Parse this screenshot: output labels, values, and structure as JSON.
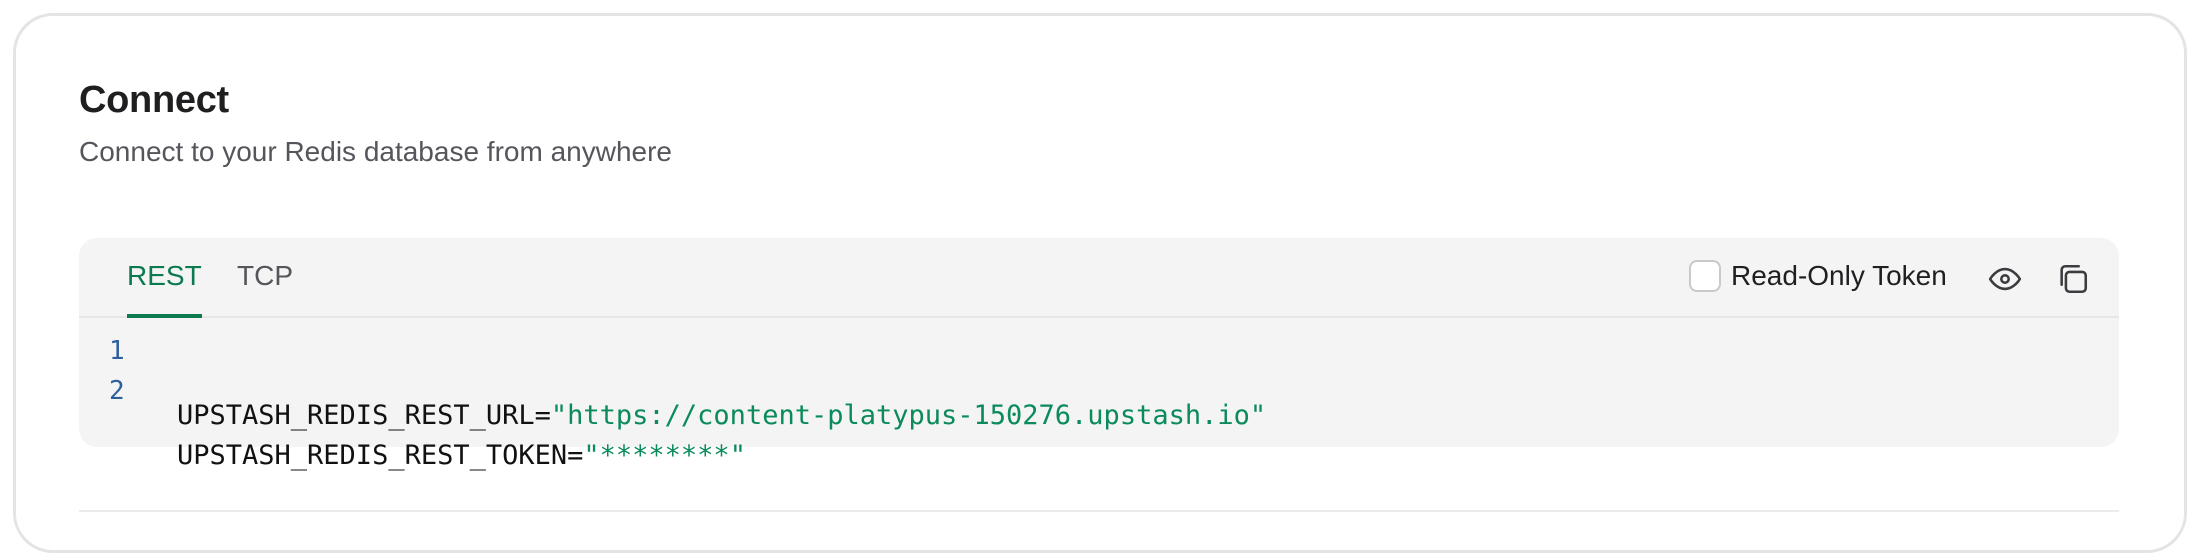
{
  "header": {
    "title": "Connect",
    "subtitle": "Connect to your Redis database from anywhere"
  },
  "tabs": [
    {
      "label": "REST",
      "active": true
    },
    {
      "label": "TCP",
      "active": false
    }
  ],
  "read_only": {
    "label": "Read-Only Token",
    "checked": false
  },
  "icons": {
    "reveal": "eye-icon",
    "copy": "copy-icon"
  },
  "code_lines": [
    {
      "number": "1",
      "key": "UPSTASH_REDIS_REST_URL=",
      "value": "\"https://content-platypus-150276.upstash.io\""
    },
    {
      "number": "2",
      "key": "UPSTASH_REDIS_REST_TOKEN=",
      "value": "\"********\""
    }
  ],
  "colors": {
    "accent": "#0b7a4f",
    "string": "#0b8a5b",
    "line_number": "#2b5f9e",
    "code_bg": "#f3f4f3"
  }
}
